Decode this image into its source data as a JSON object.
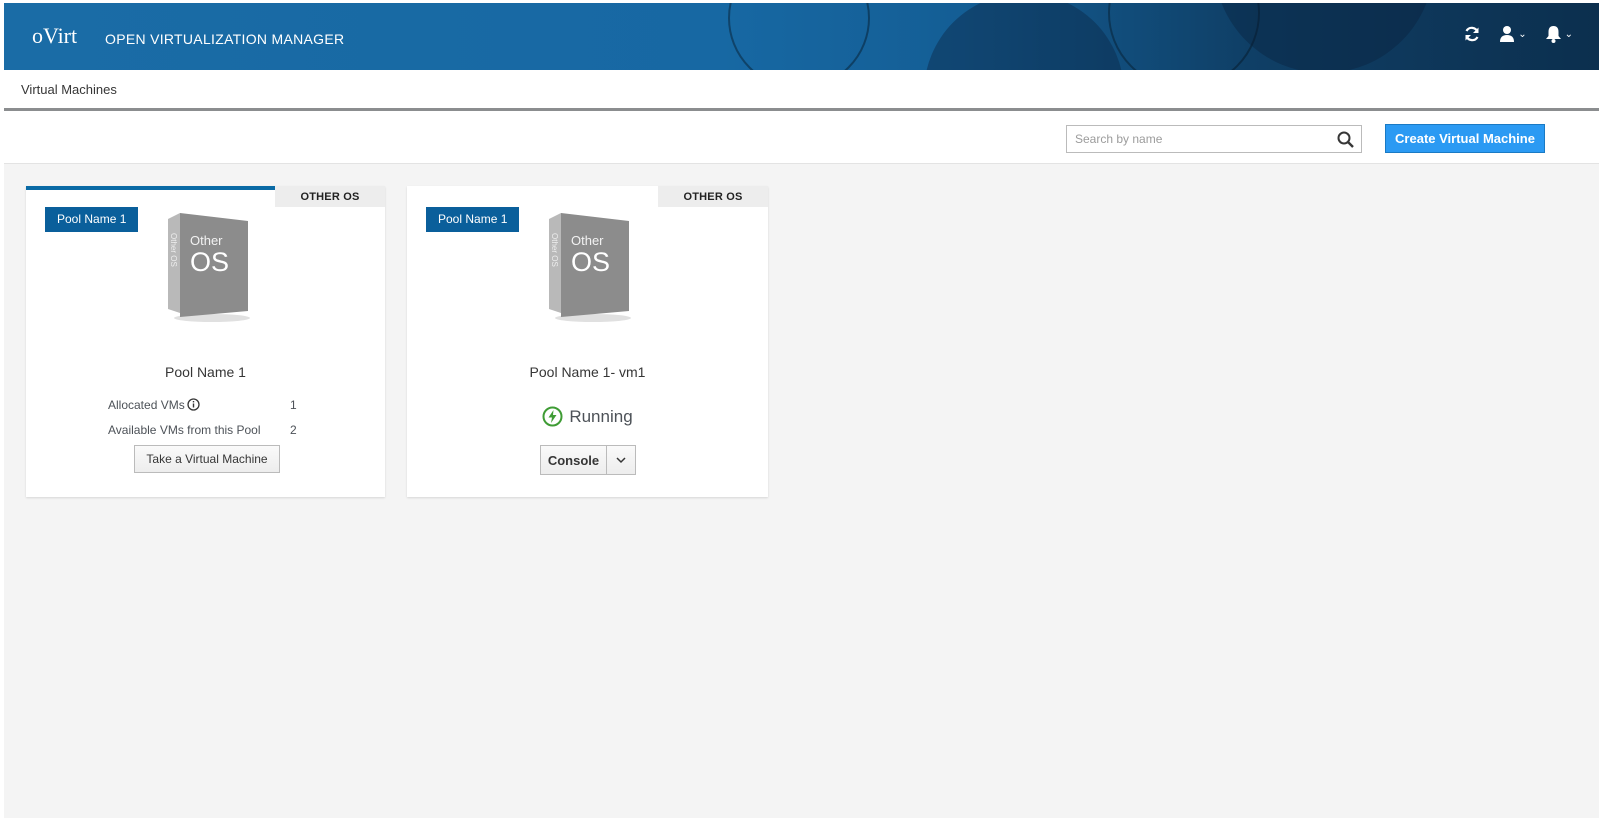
{
  "header": {
    "logo": "oVirt",
    "title": "OPEN VIRTUALIZATION MANAGER",
    "icons": [
      "refresh-icon",
      "user-icon",
      "bell-icon"
    ]
  },
  "breadcrumb": {
    "label": "Virtual Machines"
  },
  "toolbar": {
    "search_placeholder": "Search by name",
    "create_label": "Create Virtual Machine"
  },
  "cards": [
    {
      "os_tag": "OTHER OS",
      "pool_badge": "Pool Name 1",
      "os_box": {
        "big": "OS",
        "small": "Other",
        "side": "Other OS"
      },
      "name": "Pool Name 1",
      "stats": [
        {
          "label": "Allocated VMs",
          "value": "1"
        },
        {
          "label": "Available VMs from this Pool",
          "value": "2"
        }
      ],
      "action_label": "Take a Virtual Machine"
    },
    {
      "os_tag": "OTHER OS",
      "pool_badge": "Pool Name 1",
      "os_box": {
        "big": "OS",
        "small": "Other",
        "side": "Other OS"
      },
      "name": "Pool Name 1- vm1",
      "status": "Running",
      "console_label": "Console"
    }
  ],
  "colors": {
    "header": "#1a6ca6",
    "badge": "#0a5f9b",
    "primary_button": "#2b9af3",
    "running": "#3f9c35"
  }
}
